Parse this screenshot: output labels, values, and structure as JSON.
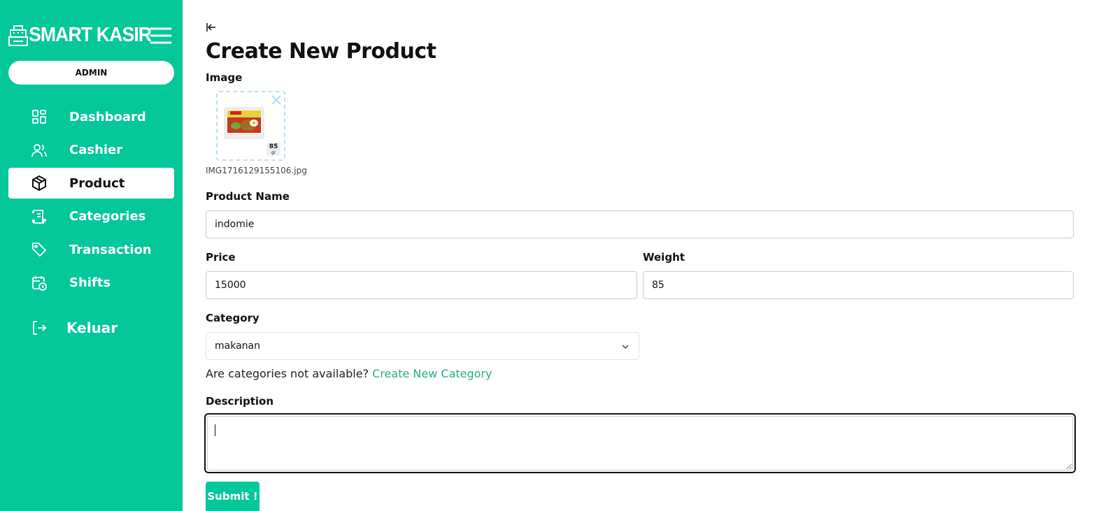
{
  "app": {
    "brand": "SMART KASIR",
    "role": "ADMIN"
  },
  "sidebar": {
    "items": [
      {
        "label": "Dashboard",
        "icon": "dashboard-icon"
      },
      {
        "label": "Cashier",
        "icon": "users-icon"
      },
      {
        "label": "Product",
        "icon": "box-icon",
        "active": true
      },
      {
        "label": "Categories",
        "icon": "receipt-icon"
      },
      {
        "label": "Transaction",
        "icon": "tag-icon"
      },
      {
        "label": "Shifts",
        "icon": "calendar-clock-icon"
      }
    ],
    "logout_label": "Keluar"
  },
  "page": {
    "title": "Create New Product",
    "image_label": "Image",
    "image_file": "IMG1716129155106.jpg",
    "image_badge": "85",
    "image_badge_unit": "gr",
    "product_name_label": "Product Name",
    "product_name_value": "indomie",
    "price_label": "Price",
    "price_value": "15000",
    "weight_label": "Weight",
    "weight_value": "85",
    "category_label": "Category",
    "category_value": "makanan",
    "category_hint": "Are categories not available?",
    "category_link": "Create New Category",
    "description_label": "Description",
    "description_value": "",
    "submit_label": "Submit !"
  },
  "colors": {
    "accent": "#04c79a",
    "link": "#22b179",
    "input_border": "#c6cbe3"
  }
}
